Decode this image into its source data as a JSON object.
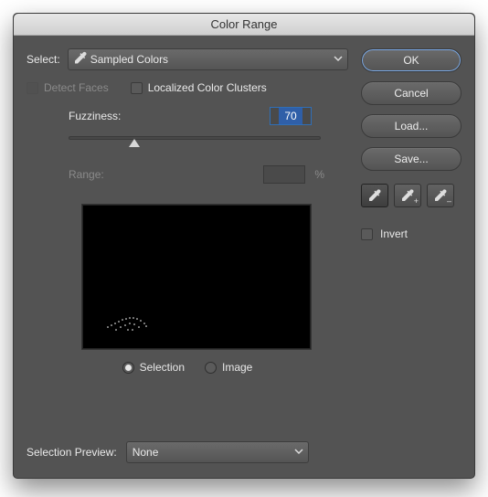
{
  "title": "Color Range",
  "select": {
    "label": "Select:",
    "value": "Sampled Colors"
  },
  "detectFaces": {
    "label": "Detect Faces",
    "checked": false,
    "enabled": false
  },
  "localizedClusters": {
    "label": "Localized Color Clusters",
    "checked": false,
    "enabled": true
  },
  "fuzziness": {
    "label": "Fuzziness:",
    "value": "70"
  },
  "range": {
    "label": "Range:",
    "unit": "%",
    "value": "",
    "enabled": false
  },
  "previewMode": {
    "selection": "Selection",
    "image": "Image",
    "checked": "selection"
  },
  "selectionPreview": {
    "label": "Selection Preview:",
    "value": "None"
  },
  "buttons": {
    "ok": "OK",
    "cancel": "Cancel",
    "load": "Load...",
    "save": "Save..."
  },
  "invert": {
    "label": "Invert",
    "checked": false
  },
  "tools": {
    "eyedropper": "eyedropper",
    "eyedropperAdd": "eyedropper-add",
    "eyedropperSubtract": "eyedropper-subtract"
  }
}
